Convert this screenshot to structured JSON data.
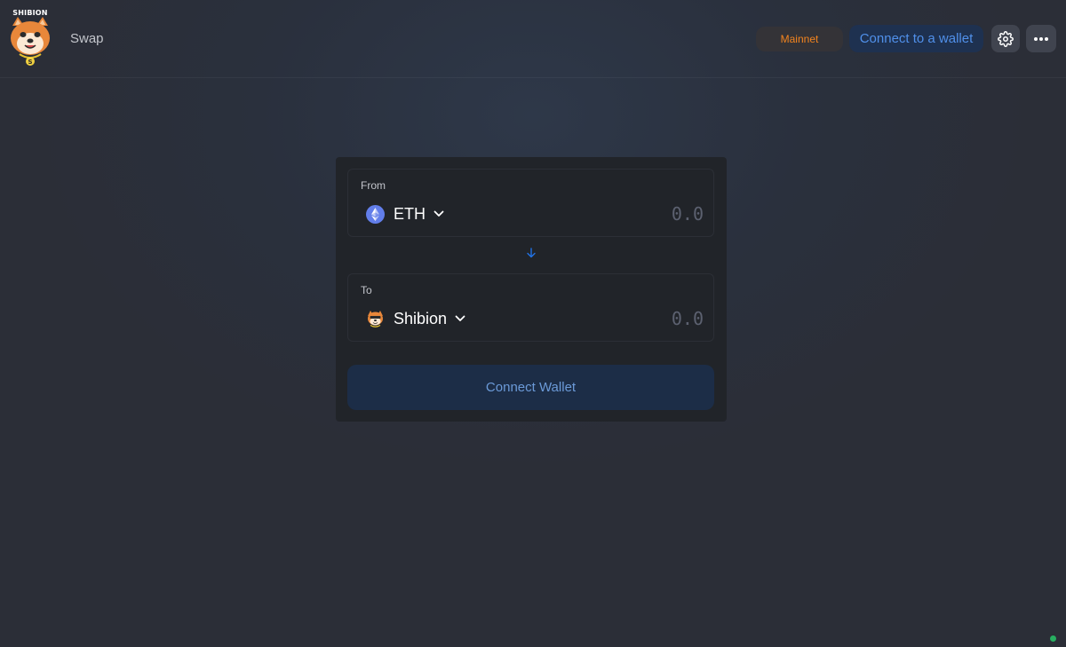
{
  "header": {
    "logo_text": "SHIBION",
    "nav_swap": "Swap",
    "network": "Mainnet",
    "connect_label": "Connect to a wallet",
    "settings_icon": "gear-icon",
    "more_icon": "ellipsis-icon"
  },
  "swap": {
    "from": {
      "label": "From",
      "token": "ETH",
      "token_icon": "eth-icon",
      "amount_placeholder": "0.0"
    },
    "switch_icon": "arrow-down-icon",
    "to": {
      "label": "To",
      "token": "Shibion",
      "token_icon": "shibion-icon",
      "amount_placeholder": "0.0"
    },
    "connect_button": "Connect Wallet"
  },
  "colors": {
    "accent": "#5090ea",
    "network": "#f3841e",
    "status": "#27ae60"
  }
}
